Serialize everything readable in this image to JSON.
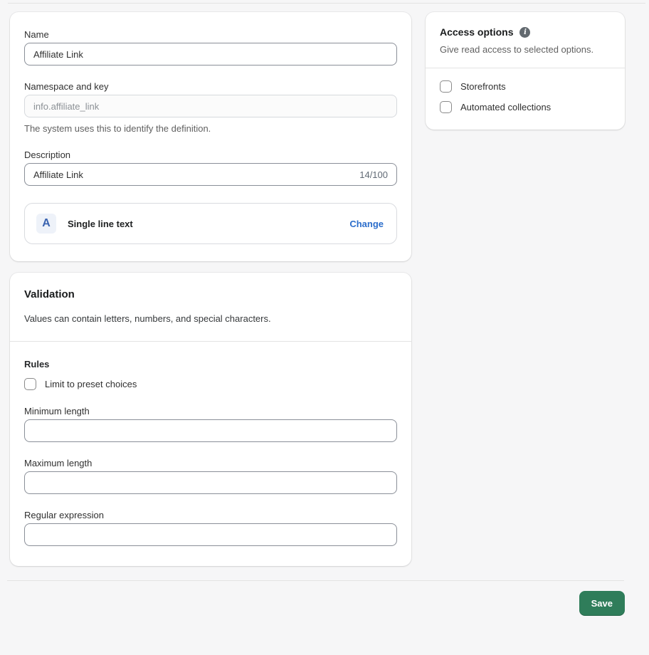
{
  "details_card": {
    "name_field": {
      "label": "Name",
      "value": "Affiliate Link"
    },
    "namespace_field": {
      "label": "Namespace and key",
      "value": "info.affiliate_link",
      "help": "The system uses this to identify the definition."
    },
    "description_field": {
      "label": "Description",
      "value": "Affiliate Link",
      "counter": "14/100"
    },
    "type_row": {
      "icon_glyph": "A",
      "label": "Single line text",
      "action": "Change"
    }
  },
  "validation_card": {
    "title": "Validation",
    "subtitle": "Values can contain letters, numbers, and special characters.",
    "rules_label": "Rules",
    "preset_checkbox_label": "Limit to preset choices",
    "min_length": {
      "label": "Minimum length",
      "value": ""
    },
    "max_length": {
      "label": "Maximum length",
      "value": ""
    },
    "regex": {
      "label": "Regular expression",
      "value": ""
    }
  },
  "access_card": {
    "title": "Access options",
    "subtitle": "Give read access to selected options.",
    "options": [
      {
        "label": "Storefronts",
        "checked": false
      },
      {
        "label": "Automated collections",
        "checked": false
      }
    ]
  },
  "footer": {
    "save_label": "Save"
  },
  "colors": {
    "page_background": "#f6f6f7",
    "accent_green": "#2f7d5a",
    "link_blue": "#2c6ecb",
    "type_icon_blue": "#3a63b0"
  }
}
